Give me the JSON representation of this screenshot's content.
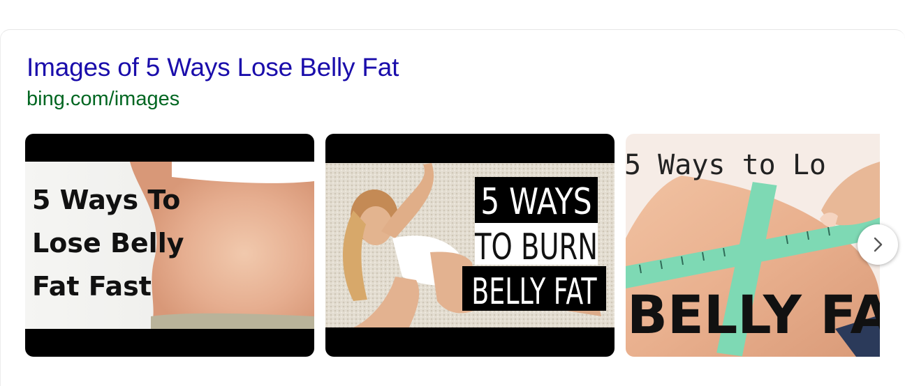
{
  "result": {
    "title": "Images of 5 Ways Lose Belly Fat",
    "source": "bing.com/images"
  },
  "thumbnails": [
    {
      "text_lines": [
        "5 Ways To",
        "Lose Belly",
        "Fat Fast"
      ]
    },
    {
      "text_lines": [
        "5 WAYS",
        "TO BURN",
        "BELLY FAT"
      ]
    },
    {
      "top_text": "5 Ways to Lo",
      "bottom_text": "BELLY FA"
    }
  ],
  "carousel": {
    "next_icon": "chevron-right-icon"
  },
  "colors": {
    "title_link": "#1a0dab",
    "source_green": "#006621",
    "tape_green": "#7ed9b4"
  }
}
